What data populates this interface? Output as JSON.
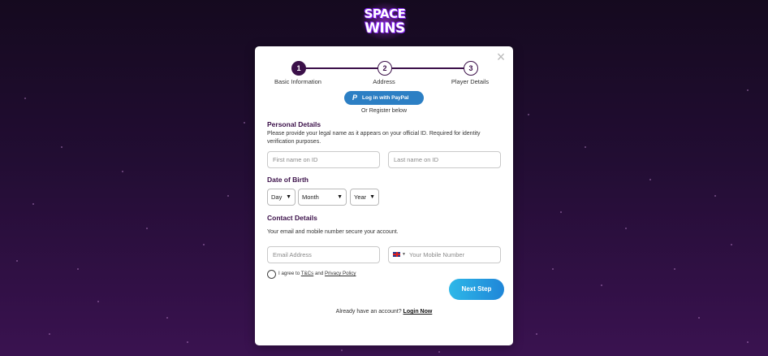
{
  "brand": {
    "logo_line1": "SPACE",
    "logo_line2": "WINS",
    "accent_color": "#3b1049",
    "button_color": "#2c7fc4"
  },
  "modal": {
    "close_icon": "close-icon",
    "steps": [
      {
        "number": "1",
        "label": "Basic Information",
        "active": true
      },
      {
        "number": "2",
        "label": "Address",
        "active": false
      },
      {
        "number": "3",
        "label": "Player Details",
        "active": false
      }
    ],
    "paypal_label": "Log in with PayPal",
    "or_register": "Or Register below",
    "personal": {
      "heading": "Personal Details",
      "description": "Please provide your legal name as it appears on your official ID. Required for identity verification purposes.",
      "first_name_placeholder": "First name on ID",
      "last_name_placeholder": "Last name on ID"
    },
    "dob": {
      "heading": "Date of Birth",
      "day": "Day",
      "month": "Month",
      "year": "Year"
    },
    "contact": {
      "heading": "Contact Details",
      "description": "Your email and mobile number secure your account.",
      "email_placeholder": "Email Address",
      "mobile_placeholder": "Your Mobile Number",
      "country_icon": "uk-flag-icon"
    },
    "agree": {
      "prefix": "I agree to ",
      "tcs": "T&Cs",
      "and": " and ",
      "privacy": "Privacy Policy"
    },
    "next_button": "Next Step",
    "already_text": "Already have an account? ",
    "login_link": "Login Now"
  }
}
